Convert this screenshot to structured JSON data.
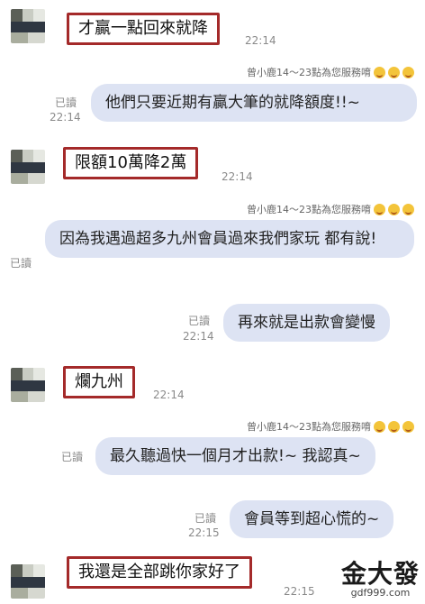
{
  "messages": [
    {
      "kind": "in",
      "text": "才贏一點回來就降",
      "time": "22:14"
    },
    {
      "kind": "sender",
      "name": "曾小鹿14～23點為您服務唷"
    },
    {
      "kind": "out",
      "text": "他們只要近期有贏大筆的就降額度!!~",
      "read": "已讀",
      "time": "22:14"
    },
    {
      "kind": "in",
      "text": "限額10萬降2萬",
      "time": "22:14"
    },
    {
      "kind": "sender",
      "name": "曾小鹿14～23點為您服務唷"
    },
    {
      "kind": "out",
      "text": "因為我遇過超多九州會員過來我們家玩 都有說!",
      "read": "已讀"
    },
    {
      "kind": "out",
      "text": "再來就是出款會變慢",
      "read": "已讀",
      "time": "22:14"
    },
    {
      "kind": "in",
      "text": "爛九州",
      "time": "22:14"
    },
    {
      "kind": "sender",
      "name": "曾小鹿14～23點為您服務唷"
    },
    {
      "kind": "out",
      "text": "最久聽過快一個月才出款!~ 我認真~",
      "read": "已讀"
    },
    {
      "kind": "out",
      "text": "會員等到超心慌的~",
      "read": "已讀",
      "time": "22:15"
    },
    {
      "kind": "in",
      "text": "我還是全部跳你家好了",
      "time": "22:15"
    }
  ],
  "watermark": {
    "name": "金大發",
    "url": "gdf999.com"
  },
  "icons": {
    "avatar": "avatar-icon",
    "emoji": "smile-emoji-icon"
  }
}
